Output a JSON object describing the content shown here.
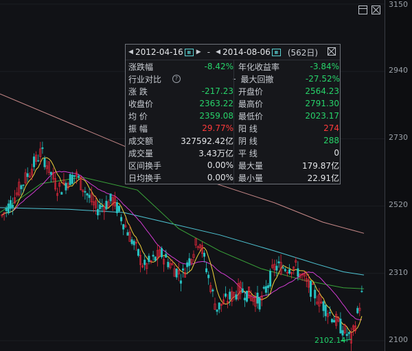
{
  "axis": {
    "prices": [
      "3150",
      "2940",
      "2730",
      "2520",
      "2310",
      "2100"
    ]
  },
  "chart_data": {
    "type": "candlestick",
    "ylim": [
      2100,
      3150
    ],
    "min_price_label": "2102.14",
    "colors": {
      "up": "#e8283c",
      "down": "#27c1c1",
      "ma_yellow": "#f2d33c",
      "ma_magenta": "#d33cd3",
      "ma_green": "#3aa53a",
      "ma_cyan": "#4fc7d6",
      "ma_pink": "#c98a8a"
    }
  },
  "panel": {
    "start_date": "2012-04-16",
    "end_date": "2014-08-06",
    "days": "(562日)",
    "cal_icon": "calendar-icon",
    "rows": [
      {
        "l1": "涨跌幅",
        "v1": "-8.42%",
        "c1": "#27d36a",
        "l2": "年化收益率",
        "v2": "-3.84%",
        "c2": "#27d36a"
      },
      {
        "l1": "行业对比",
        "v1": "-",
        "c1": "#c9cdd3",
        "l2": "最大回撤",
        "v2": "-27.52%",
        "c2": "#27d36a"
      },
      {
        "l1": "涨  跌",
        "v1": "-217.23",
        "c1": "#27d36a",
        "l2": "开盘价",
        "v2": "2564.23",
        "c2": "#27d36a"
      },
      {
        "l1": "收盘价",
        "v1": "2363.22",
        "c1": "#27d36a",
        "l2": "最高价",
        "v2": "2791.30",
        "c2": "#27d36a"
      },
      {
        "l1": "均  价",
        "v1": "2359.08",
        "c1": "#27d36a",
        "l2": "最低价",
        "v2": "2023.17",
        "c2": "#27d36a"
      },
      {
        "l1": "振  幅",
        "v1": "29.77%",
        "c1": "#ff3b3b",
        "l2": "阳  线",
        "v2": "274",
        "c2": "#ff3b3b"
      },
      {
        "l1": "成交额",
        "v1": "327592.42亿",
        "c1": "#e5e7ea",
        "l2": "阴  线",
        "v2": "288",
        "c2": "#27d36a"
      },
      {
        "l1": "成交量",
        "v1": "3.43万亿",
        "c1": "#e5e7ea",
        "l2": "平  线",
        "v2": "0",
        "c2": "#e5e7ea"
      },
      {
        "l1": "区间换手",
        "v1": "0.00%",
        "c1": "#e5e7ea",
        "l2": "最大量",
        "v2": "179.87亿",
        "c2": "#e5e7ea"
      },
      {
        "l1": "日均换手",
        "v1": "0.00%",
        "c1": "#e5e7ea",
        "l2": "最小量",
        "v2": "22.91亿",
        "c2": "#e5e7ea"
      }
    ]
  }
}
